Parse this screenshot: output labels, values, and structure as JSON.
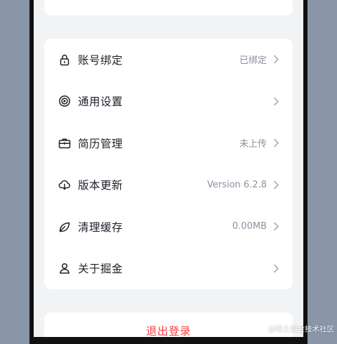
{
  "menu": {
    "items": [
      {
        "label": "账号绑定",
        "value": "已绑定",
        "icon": "lock-icon"
      },
      {
        "label": "通用设置",
        "value": "",
        "icon": "settings-icon"
      },
      {
        "label": "简历管理",
        "value": "未上传",
        "icon": "briefcase-icon"
      },
      {
        "label": "版本更新",
        "value": "Version 6.2.8",
        "icon": "cloud-download-icon"
      },
      {
        "label": "清理缓存",
        "value": "0.00MB",
        "icon": "leaf-icon"
      },
      {
        "label": "关于掘金",
        "value": "",
        "icon": "user-icon"
      }
    ]
  },
  "logout": {
    "label": "退出登录"
  },
  "watermark": "@稀土掘金技术社区",
  "colors": {
    "danger": "#f53f3f",
    "text": "#1d2129",
    "muted": "#8a919f",
    "background": "#f2f3f5"
  }
}
